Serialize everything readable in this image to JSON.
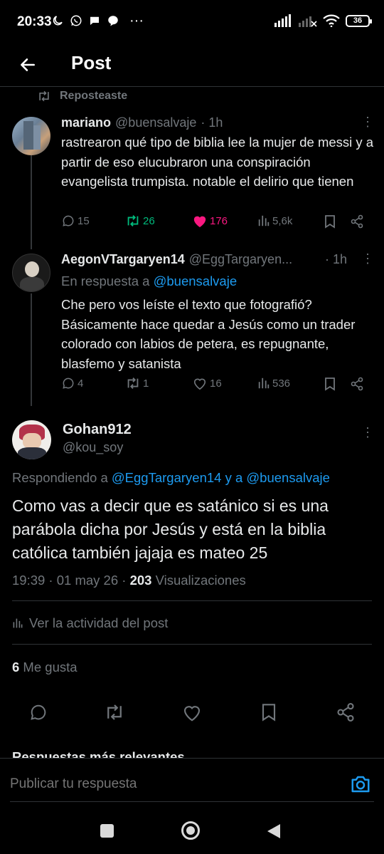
{
  "status_bar": {
    "time": "20:33",
    "battery": "36"
  },
  "header": {
    "title": "Post"
  },
  "repost_indicator": "Reposteaste",
  "tweet1": {
    "name": "mariano",
    "handle": "@buensalvaje",
    "time": "· 1h",
    "text": "rastrearon qué tipo de biblia lee la mujer de messi y a partir de eso elucubraron una conspiración evangelista trumpista. notable el delirio que tienen",
    "replies": "15",
    "reposts": "26",
    "likes": "176",
    "views": "5,6k",
    "colors": {
      "repost": "#00ba7c",
      "like": "#f91880"
    }
  },
  "tweet2": {
    "name": "AegonVTargaryen14",
    "handle": "@EggTargaryen...",
    "time": "· 1h",
    "reply_prefix": "En respuesta a",
    "reply_to": "@buensalvaje",
    "text": "Che pero vos leíste el texto que fotografió? Básicamente hace quedar a Jesús como un trader colorado con labios de petera, es repugnante, blasfemo y satanista",
    "replies": "4",
    "reposts": "1",
    "likes": "16",
    "views": "536"
  },
  "main_post": {
    "name": "Gohan912",
    "handle": "@kou_soy",
    "replying_prefix": "Respondiendo a",
    "replying_to": "@EggTargaryen14 y a @buensalvaje",
    "text": "Como vas a decir que es satánico si es una parábola dicha por Jesús y está en la biblia católica también jajaja es mateo 25",
    "meta_time": "19:39 · 01 may 26 · ",
    "meta_views_count": "203",
    "meta_views_label": " Visualizaciones",
    "activity_link": "Ver la actividad del post",
    "likes_count": "6",
    "likes_label": " Me gusta"
  },
  "sort_label": "Respuestas más relevantes",
  "reply_placeholder": "Publicar tu respuesta",
  "accent_color": "#1d9bf0"
}
